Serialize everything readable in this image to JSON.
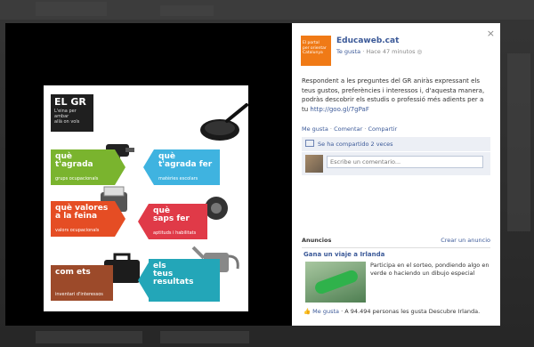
{
  "poster": {
    "gr_title": "EL GR",
    "gr_subtitle": "L'eina per\nambar\nallà on vols",
    "tiles": {
      "green": {
        "title": "què\nt'agrada",
        "subtitle": "grups ocupacionals"
      },
      "blue": {
        "title": "què\nt'agrada fer",
        "subtitle": "matèries escolars"
      },
      "red": {
        "title": "què valores\na la feina",
        "subtitle": "valors ocupacionals"
      },
      "pink": {
        "title": "què\nsaps fer",
        "subtitle": "aptituds i habilitats"
      },
      "brown": {
        "title": "com ets",
        "subtitle": "inventari d'interessos"
      },
      "teal": {
        "title": "els\nteus\nresultats"
      }
    }
  },
  "panel": {
    "close": "×",
    "logo_text": "El portal\nper orientar\nCatalunya",
    "page_name": "Educaweb.cat",
    "like_link": "Te gusta",
    "time": "· Hace 47 minutos",
    "post_text": "Respondent a les preguntes del GR aniràs expressant els teus gustos, preferències i interessos i, d'aquesta manera, podràs descobrir els estudis o professió més adients per a tu",
    "post_link": "http://goo.gl/7gPaF",
    "actions": {
      "like": "Me gusta",
      "comment": "Comentar",
      "share": "Compartir",
      "sep": "·"
    },
    "shared": "Se ha compartido 2 veces",
    "comment_placeholder": "Escribe un comentario...",
    "ads": {
      "title": "Anuncios",
      "create": "Crear un anuncio",
      "ad_title": "Gana un viaje a Irlanda",
      "ad_text": "Participa en el sorteo, pondiendo algo en verde o haciendo un dibujo especial",
      "ad_like": "Me gusta",
      "ad_like_count": "· A 94.494 personas les gusta Descubre Irlanda."
    }
  },
  "colors": {
    "link": "#3b5998",
    "logo": "#f07a16"
  }
}
